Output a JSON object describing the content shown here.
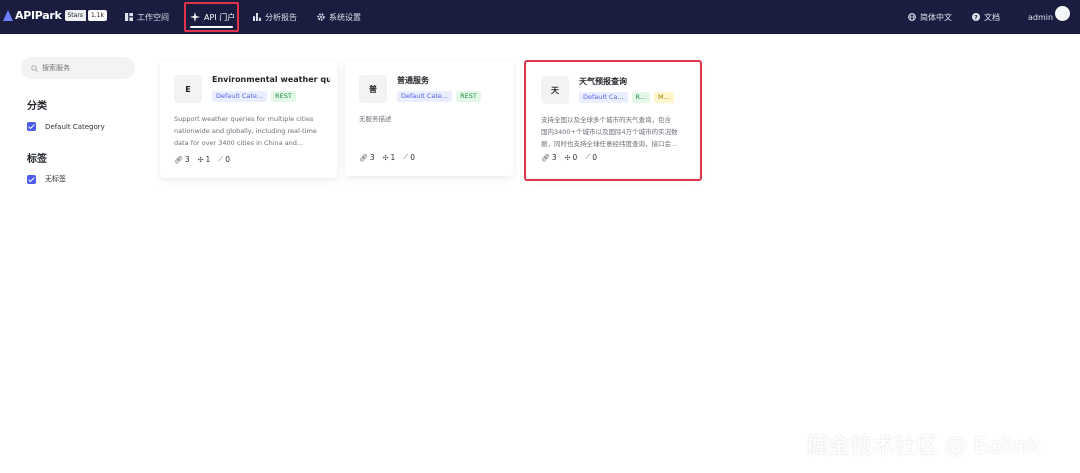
{
  "topbar": {
    "logo": "APIPark",
    "badge_label": "Stars",
    "badge_count": "1.1k",
    "nav": [
      {
        "label": "工作空间",
        "icon": "grid-icon"
      },
      {
        "label": "API 门户",
        "icon": "sparkle-icon"
      },
      {
        "label": "分析报告",
        "icon": "bar-chart-icon"
      },
      {
        "label": "系统设置",
        "icon": "gear-icon"
      }
    ],
    "language": "简体中文",
    "docs": "文档",
    "user": "admin",
    "bg_color": "#1a1d3f"
  },
  "sidebar": {
    "search_placeholder": "搜索服务",
    "category_title": "分类",
    "categories": [
      {
        "label": "Default Category",
        "checked": true
      }
    ],
    "tag_title": "标签",
    "tags": [
      {
        "label": "无标签",
        "checked": true
      }
    ]
  },
  "cards": [
    {
      "avatar": "E",
      "title": "Environmental weather quer",
      "tags": [
        "Default Cate...",
        "REST"
      ],
      "desc": [
        "Support weather queries for multiple cities",
        "nationwide and globally, including real-time",
        "data for over 3400 cities in China and..."
      ],
      "stats": {
        "apis": "3",
        "subs": "1",
        "calls": "0"
      }
    },
    {
      "avatar": "普",
      "title": "普通服务",
      "tags": [
        "Default Cate...",
        "REST"
      ],
      "desc": [
        "无服务描述"
      ],
      "stats": {
        "apis": "3",
        "subs": "1",
        "calls": "0"
      }
    },
    {
      "avatar": "天",
      "title": "天气预报查询",
      "tags": [
        "Default Ca...",
        "R...",
        "M..."
      ],
      "desc": [
        "支持全国以及全球多个城市的天气查询，包含",
        "国内3400+个城市以及国际4万个城市的实况数",
        "据，同时也支持全球任意经纬度查询，接口会..."
      ],
      "stats": {
        "apis": "3",
        "subs": "0",
        "calls": "0"
      }
    }
  ],
  "watermark": "掘金技术社区 @ Eolink",
  "accent": "#4b5de8",
  "highlight_color": "#e0344c"
}
